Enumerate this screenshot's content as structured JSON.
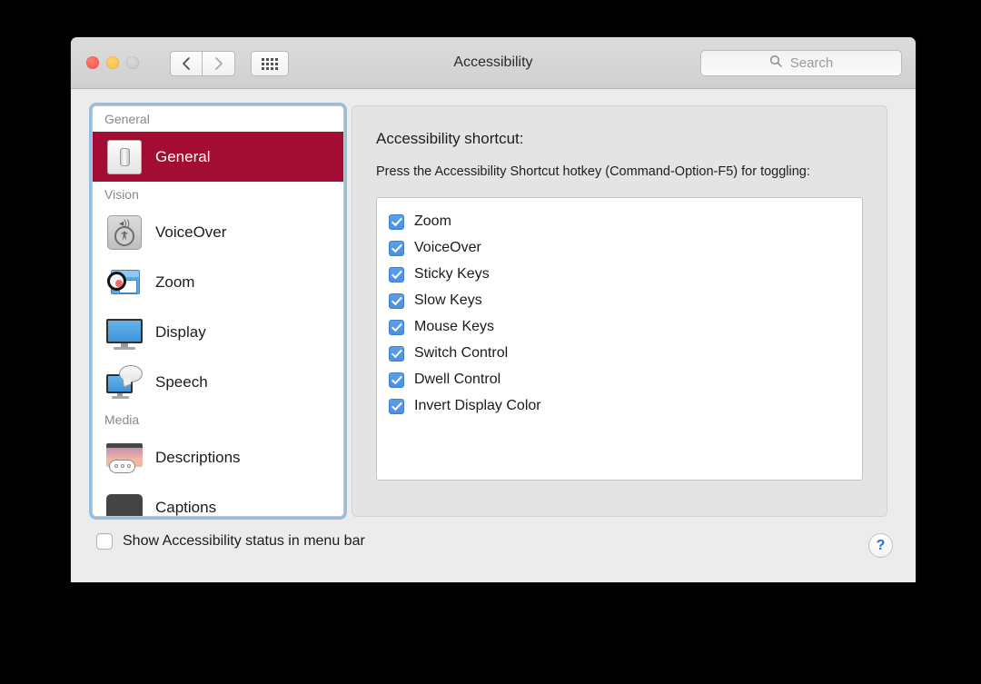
{
  "window": {
    "title": "Accessibility",
    "traffic_lights": [
      "close",
      "minimize",
      "zoom"
    ],
    "nav": {
      "back": "‹",
      "forward": "›"
    },
    "grid_button": "show-all-icon",
    "search": {
      "placeholder": "Search",
      "value": "",
      "icon": "search-icon"
    }
  },
  "sidebar": {
    "groups": [
      {
        "header": "General",
        "items": [
          {
            "label": "General",
            "icon": "light-switch-icon",
            "selected": true
          }
        ]
      },
      {
        "header": "Vision",
        "items": [
          {
            "label": "VoiceOver",
            "icon": "voiceover-icon",
            "selected": false
          },
          {
            "label": "Zoom",
            "icon": "zoom-loupe-icon",
            "selected": false
          },
          {
            "label": "Display",
            "icon": "display-monitor-icon",
            "selected": false
          },
          {
            "label": "Speech",
            "icon": "speech-bubble-icon",
            "selected": false
          }
        ]
      },
      {
        "header": "Media",
        "items": [
          {
            "label": "Descriptions",
            "icon": "descriptions-icon",
            "selected": false
          },
          {
            "label": "Captions",
            "icon": "captions-icon",
            "selected": false
          }
        ]
      }
    ]
  },
  "main": {
    "title": "Accessibility shortcut:",
    "description": "Press the Accessibility Shortcut hotkey (Command-Option-F5) for toggling:",
    "shortcut_options": [
      {
        "label": "Zoom",
        "checked": true
      },
      {
        "label": "VoiceOver",
        "checked": true
      },
      {
        "label": "Sticky Keys",
        "checked": true
      },
      {
        "label": "Slow Keys",
        "checked": true
      },
      {
        "label": "Mouse Keys",
        "checked": true
      },
      {
        "label": "Switch Control",
        "checked": true
      },
      {
        "label": "Dwell Control",
        "checked": true
      },
      {
        "label": "Invert Display Color",
        "checked": true
      }
    ]
  },
  "footer": {
    "menu_bar_checkbox": {
      "label": "Show Accessibility status in menu bar",
      "checked": false
    },
    "help_button": "?"
  },
  "colors": {
    "selection": "#a30c33",
    "checkbox_on": "#4c8fe0",
    "focus_ring": "#78afe2",
    "help_glyph": "#1e6fd9",
    "window_bg": "#ececec",
    "panel_bg": "#e4e4e4",
    "desktop_bg": "#000000"
  }
}
